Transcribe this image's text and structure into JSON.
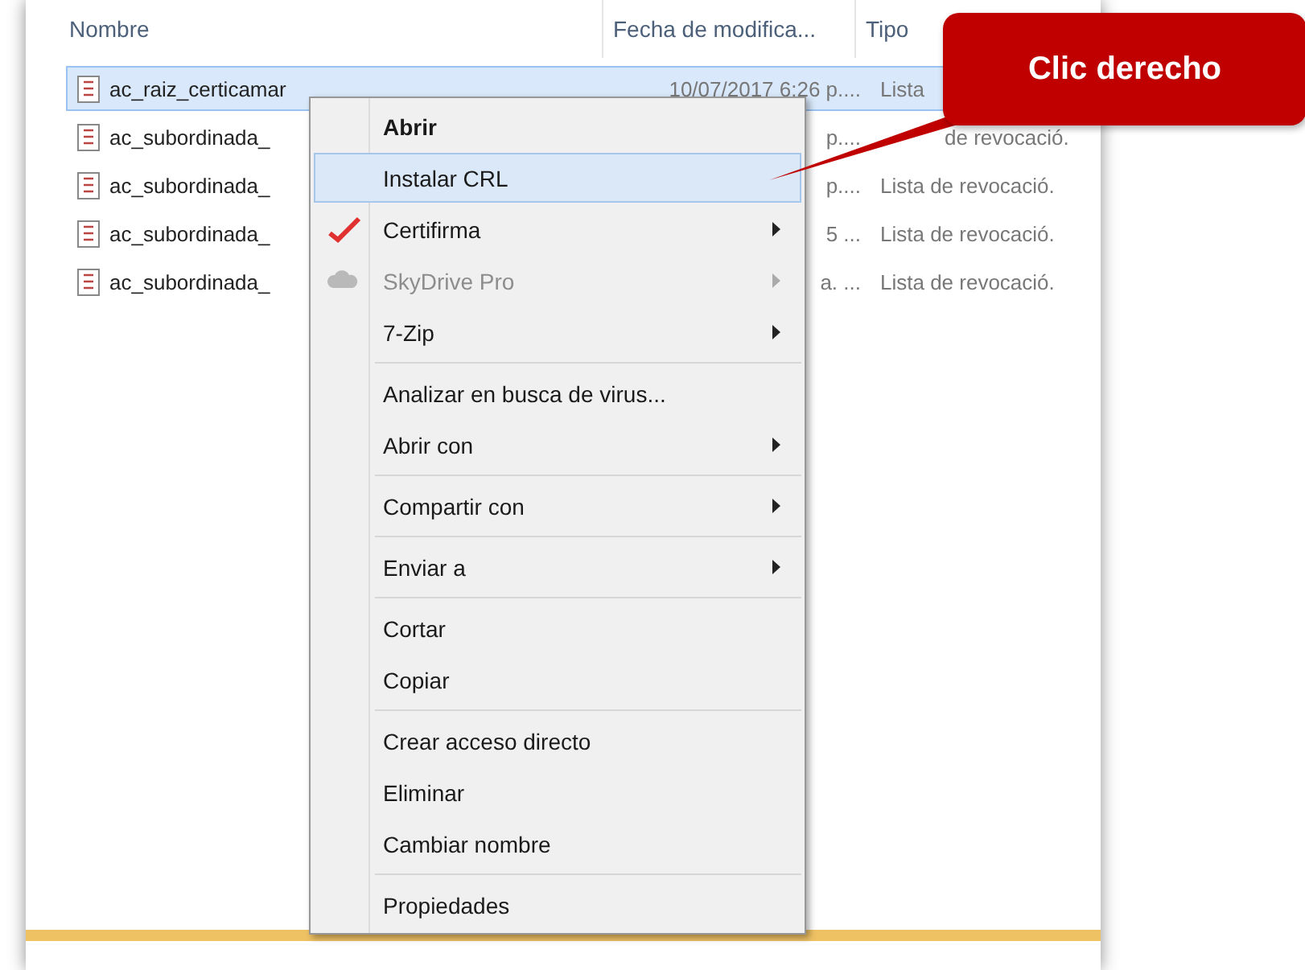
{
  "columns": [
    "Nombre",
    "Fecha de modifica...",
    "Tipo"
  ],
  "files": [
    {
      "name": "ac_raiz_certicamar",
      "date": "10/07/2017 6:26 p....",
      "type": "Lista",
      "kind": "full",
      "selected": true
    },
    {
      "name": "ac_subordinada_",
      "date": "p....",
      "type": "de revocació.",
      "kind": "partial",
      "selected": false
    },
    {
      "name": "ac_subordinada_",
      "date": "p....",
      "type": "Lista de revocació.",
      "kind": "full",
      "selected": false
    },
    {
      "name": "ac_subordinada_",
      "date": "5 ...",
      "type": "Lista de revocació.",
      "kind": "full",
      "selected": false
    },
    {
      "name": "ac_subordinada_",
      "date": "a. ...",
      "type": "Lista de revocació.",
      "kind": "full",
      "selected": false
    }
  ],
  "context_menu": [
    [
      {
        "label": "Abrir",
        "bold": true,
        "selected": false,
        "disabled": false,
        "submenu": false
      },
      {
        "label": "Instalar CRL",
        "bold": false,
        "selected": true,
        "disabled": false,
        "submenu": false
      },
      {
        "label": "Certifirma",
        "bold": false,
        "selected": false,
        "disabled": false,
        "submenu": true,
        "kind": "check"
      },
      {
        "label": "SkyDrive Pro",
        "bold": false,
        "selected": false,
        "disabled": true,
        "submenu": true,
        "kind": "cloud"
      },
      {
        "label": "7-Zip",
        "bold": false,
        "selected": false,
        "disabled": false,
        "submenu": true
      }
    ],
    [
      {
        "label": "Analizar en busca de virus...",
        "bold": false,
        "selected": false,
        "disabled": false,
        "submenu": false
      },
      {
        "label": "Abrir con",
        "bold": false,
        "selected": false,
        "disabled": false,
        "submenu": true
      }
    ],
    [
      {
        "label": "Compartir con",
        "bold": false,
        "selected": false,
        "disabled": false,
        "submenu": true
      }
    ],
    [
      {
        "label": "Enviar a",
        "bold": false,
        "selected": false,
        "disabled": false,
        "submenu": true
      }
    ],
    [
      {
        "label": "Cortar",
        "bold": false,
        "selected": false,
        "disabled": false,
        "submenu": false
      },
      {
        "label": "Copiar",
        "bold": false,
        "selected": false,
        "disabled": false,
        "submenu": false
      }
    ],
    [
      {
        "label": "Crear acceso directo",
        "bold": false,
        "selected": false,
        "disabled": false,
        "submenu": false
      },
      {
        "label": "Eliminar",
        "bold": false,
        "selected": false,
        "disabled": false,
        "submenu": false
      },
      {
        "label": "Cambiar nombre",
        "bold": false,
        "selected": false,
        "disabled": false,
        "submenu": false
      }
    ],
    [
      {
        "label": "Propiedades",
        "bold": false,
        "selected": false,
        "disabled": false,
        "submenu": false
      }
    ]
  ],
  "callout": {
    "text": "Clic derecho"
  }
}
